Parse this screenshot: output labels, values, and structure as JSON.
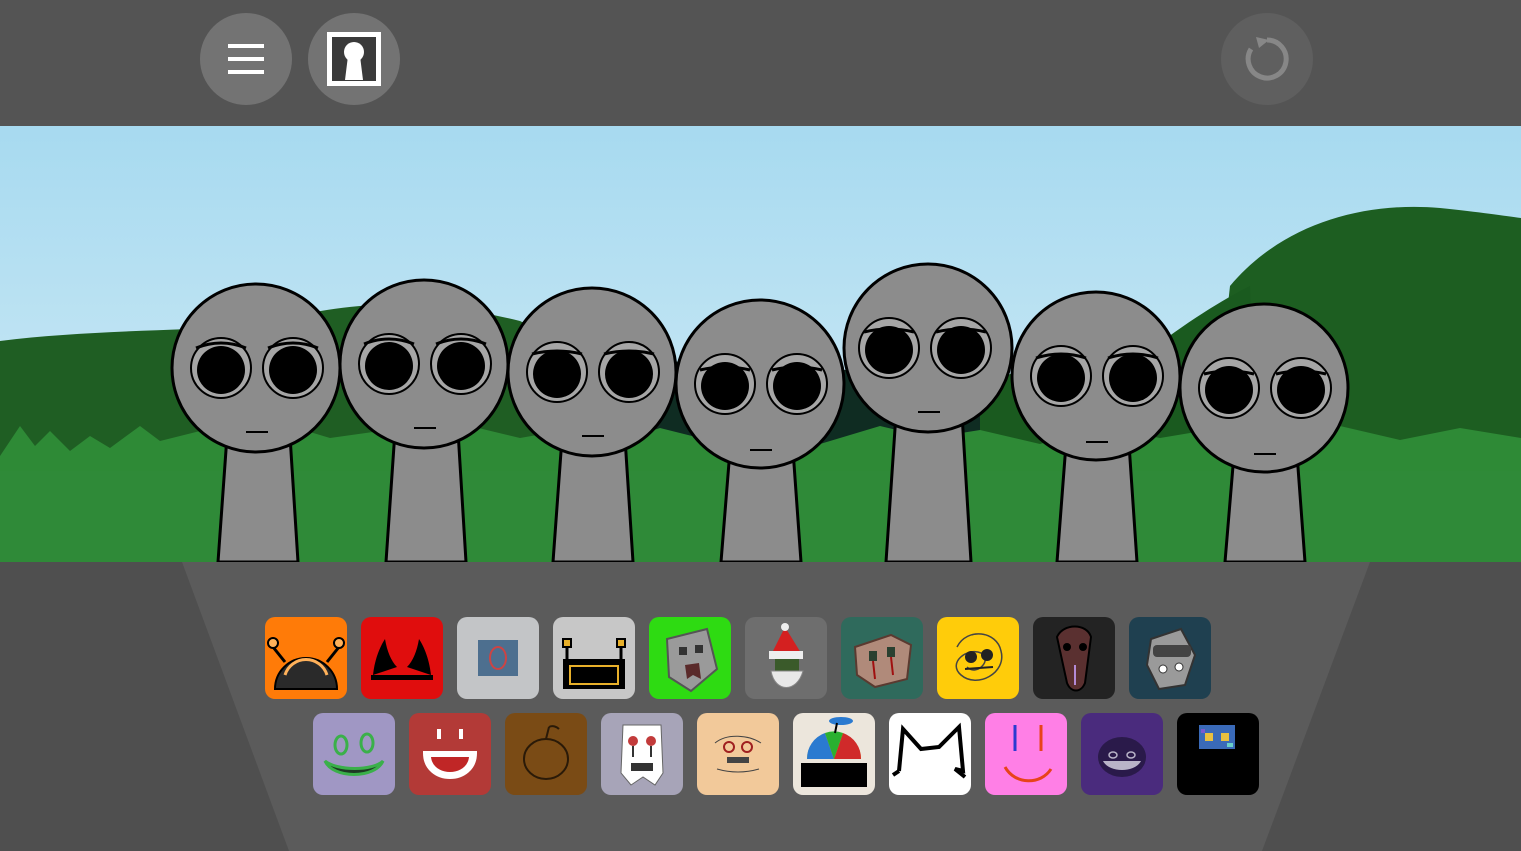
{
  "toolbar": {
    "menu_icon": "hamburger-menu-icon",
    "portrait_icon": "keyhole-portrait-icon",
    "reset_icon": "reset-circular-arrow-icon"
  },
  "stage": {
    "characters": [
      {
        "name": "character-1"
      },
      {
        "name": "character-2"
      },
      {
        "name": "character-3"
      },
      {
        "name": "character-4"
      },
      {
        "name": "character-5"
      },
      {
        "name": "character-6"
      },
      {
        "name": "character-7"
      }
    ]
  },
  "palette": {
    "row1": [
      {
        "icon": "orange-antenna-dome-icon",
        "color": "#ff7b08"
      },
      {
        "icon": "red-devil-horns-icon",
        "color": "#e00d0d"
      },
      {
        "icon": "gray-square-ring-icon",
        "color": "#c3c5c7"
      },
      {
        "icon": "gray-antenna-box-icon",
        "color": "#c7c7c7"
      },
      {
        "icon": "green-creeper-face-icon",
        "color": "#2edb12"
      },
      {
        "icon": "santa-hat-beard-icon",
        "color": "#6e6e6e"
      },
      {
        "icon": "teal-torn-paper-face-icon",
        "color": "#2f6a5c"
      },
      {
        "icon": "yellow-scribble-face-icon",
        "color": "#ffcc0a"
      },
      {
        "icon": "dark-long-mask-icon",
        "color": "#232323"
      },
      {
        "icon": "navy-helmet-icon",
        "color": "#1f4050"
      }
    ],
    "row2": [
      {
        "icon": "lavender-goo-face-icon",
        "color": "#a097c4"
      },
      {
        "icon": "red-grin-face-icon",
        "color": "#b33a37"
      },
      {
        "icon": "brown-pumpkin-icon",
        "color": "#7a4b15"
      },
      {
        "icon": "ghost-face-icon",
        "color": "#a7a4b8"
      },
      {
        "icon": "beige-sketch-face-icon",
        "color": "#f2c99a"
      },
      {
        "icon": "propeller-cap-icon",
        "color": "#ece6dc"
      },
      {
        "icon": "white-cat-ears-icon",
        "color": "#ffffff"
      },
      {
        "icon": "pink-smile-face-icon",
        "color": "#ff7fe6"
      },
      {
        "icon": "purple-blob-face-icon",
        "color": "#4a2b7d"
      },
      {
        "icon": "black-pixel-goggles-icon",
        "color": "#000000"
      }
    ]
  }
}
